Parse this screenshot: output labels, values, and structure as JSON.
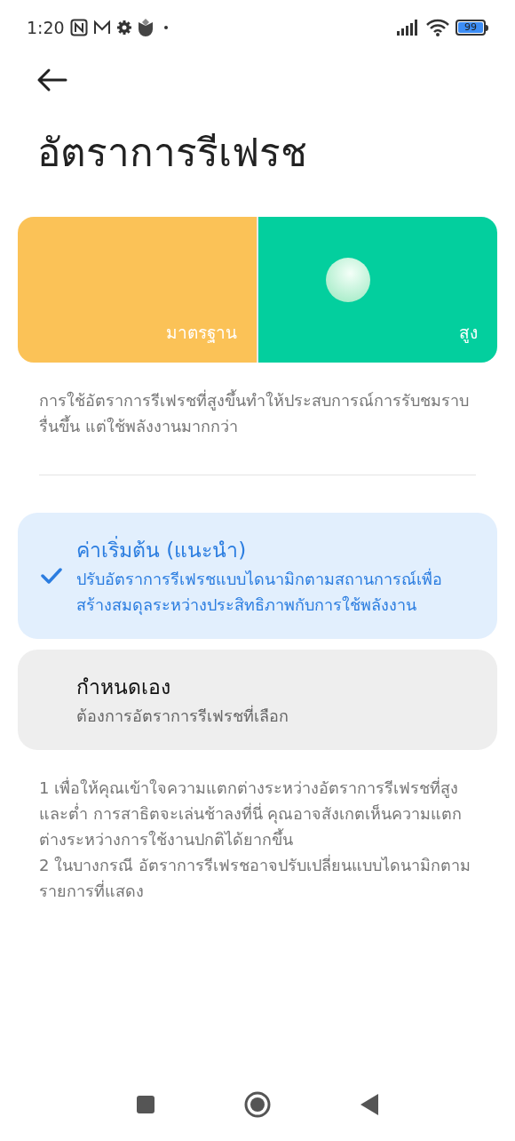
{
  "status_bar": {
    "time": "1:20",
    "battery": "99"
  },
  "title": "อัตราการรีเฟรช",
  "demo": {
    "segments": [
      {
        "label": "มาตรฐาน",
        "color": "#fbc257",
        "selected": false
      },
      {
        "label": "สูง",
        "color": "#03cf9e",
        "selected": true
      }
    ]
  },
  "description": "การใช้อัตราการรีเฟรชที่สูงขึ้นทำให้ประสบการณ์การรับชมราบรื่นขึ้น แต่ใช้พลังงานมากกว่า",
  "options": [
    {
      "title": "ค่าเริ่มต้น (แนะนำ)",
      "subtitle": "ปรับอัตราการรีเฟรชแบบไดนามิกตามสถานการณ์เพื่อสร้างสมดุลระหว่างประสิทธิภาพกับการใช้พลังงาน",
      "selected": true
    },
    {
      "title": "กำหนดเอง",
      "subtitle": "ต้องการอัตราการรีเฟรชที่เลือก",
      "selected": false
    }
  ],
  "notes": [
    "1 เพื่อให้คุณเข้าใจความแตกต่างระหว่างอัตราการรีเฟรชที่สูงและต่ำ การสาธิตจะเล่นช้าลงที่นี่ คุณอาจสังเกตเห็นความแตกต่างระหว่างการใช้งานปกติได้ยากขึ้น",
    "2 ในบางกรณี อัตราการรีเฟรชอาจปรับเปลี่ยนแบบไดนามิกตามรายการที่แสดง"
  ]
}
